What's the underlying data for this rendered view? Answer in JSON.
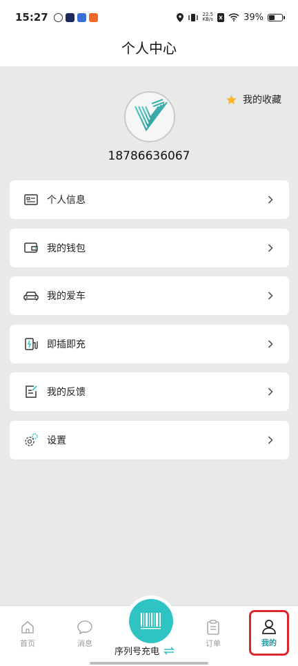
{
  "status_bar": {
    "time": "15:27",
    "speed_top": "22.5",
    "speed_bottom": "KB/s",
    "battery": "39%",
    "battery_level": 0.39
  },
  "header": {
    "title": "个人中心"
  },
  "profile": {
    "phone": "18786636067",
    "favorites_label": "我的收藏"
  },
  "menu": [
    {
      "label": "个人信息",
      "icon": "id-card-icon"
    },
    {
      "label": "我的钱包",
      "icon": "wallet-icon"
    },
    {
      "label": "我的爱车",
      "icon": "car-icon"
    },
    {
      "label": "即插即充",
      "icon": "charger-icon"
    },
    {
      "label": "我的反馈",
      "icon": "feedback-icon"
    },
    {
      "label": "设置",
      "icon": "settings-icon"
    }
  ],
  "bottom_nav": {
    "home": "首页",
    "messages": "消息",
    "scan": "序列号充电",
    "orders": "订单",
    "mine": "我的"
  },
  "colors": {
    "accent": "#2ec4c4",
    "active_nav": "#1b9a9f",
    "highlight_box": "#d8262b",
    "star": "#f5b82e"
  }
}
